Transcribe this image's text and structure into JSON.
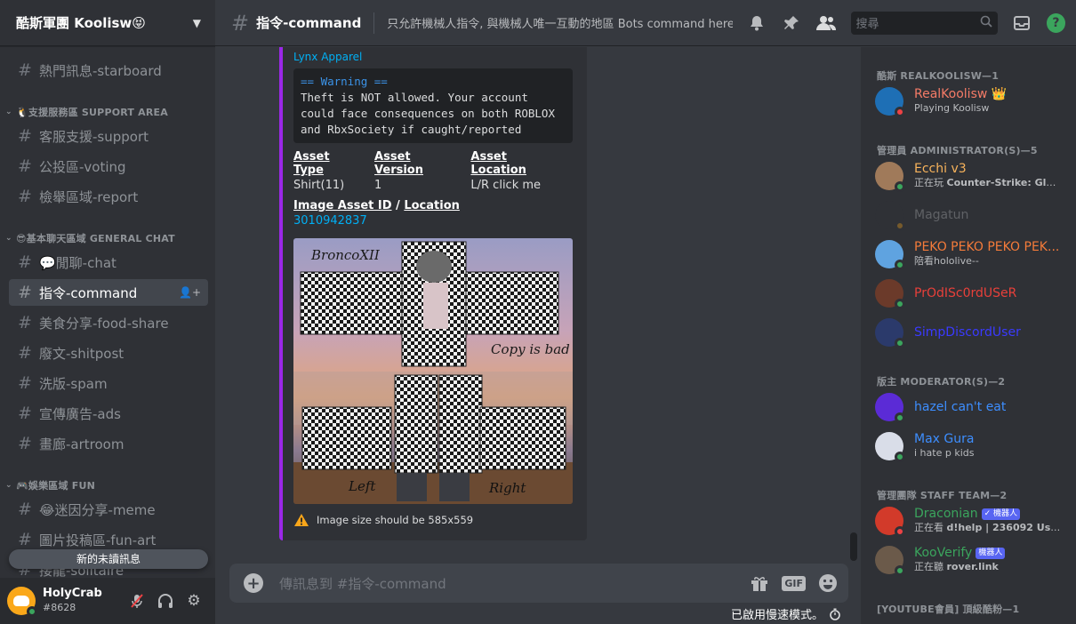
{
  "server": {
    "name": "酷斯軍團 Koolisw😝"
  },
  "sidebar": {
    "top_channel": "熱門訊息-starboard",
    "categories": [
      {
        "name": "🐧支援服務區 SUPPORT AREA",
        "channels": [
          "客服支援-support",
          "公投區-voting",
          "檢舉區域-report"
        ]
      },
      {
        "name": "😎基本聊天區域 GENERAL CHAT",
        "channels": [
          "💬閒聊-chat",
          "指令-command",
          "美食分享-food-share",
          "廢文-shitpost",
          "洗版-spam",
          "宣傳廣告-ads",
          "畫廊-artroom"
        ]
      },
      {
        "name": "🎮娛樂區域 FUN",
        "channels": [
          "😂迷因分享-meme",
          "圖片投稿區-fun-art",
          "接龍-solitaire"
        ]
      }
    ],
    "active_channel": "指令-command",
    "unread_pill": "新的未讀訊息"
  },
  "user": {
    "name": "HolyCrab",
    "tag": "#8628"
  },
  "header": {
    "channel": "指令-command",
    "topic": "只允許機械人指令, 與機械人唯一互動的地區 Bots command here.",
    "search_placeholder": "搜尋"
  },
  "embed": {
    "provider": "Lynx Apparel",
    "code_warning": "== Warning ==",
    "code_body": "Theft is NOT allowed. Your account\ncould face consequences on both ROBLOX\nand RbxSociety if caught/reported",
    "fields": [
      {
        "name": "Asset Type",
        "value": "Shirt(11)"
      },
      {
        "name": "Asset Version",
        "value": "1"
      },
      {
        "name": "Asset Location",
        "value": "L/R click me"
      }
    ],
    "image_field_a": "Image Asset ID",
    "image_field_sep": " / ",
    "image_field_b": "Location",
    "image_asset_id": "3010942837",
    "image_texts": {
      "creator": "BroncoXII",
      "copy": "Copy is bad",
      "left": "Left",
      "right": "Right"
    },
    "footer": "Image size should be 585x559"
  },
  "composer": {
    "placeholder": "傳訊息到 #指令-command",
    "slowmode": "已啟用慢速模式。"
  },
  "members": {
    "groups": [
      {
        "title": "酷斯 REALKOOLISW—1",
        "members": [
          {
            "name": "RealKoolisw",
            "suffix": "👑",
            "activity": "Playing Koolisw",
            "color": "#f47b67",
            "status": "dnd",
            "avatar": "#1e6fb5"
          }
        ]
      },
      {
        "title": "管理員 ADMINISTRATOR(S)—5",
        "members": [
          {
            "name": "Ecchi v3",
            "activity_prefix": "正在玩 ",
            "activity": "Counter-Strike: Global ...",
            "color": "#f8b35b",
            "status": "online",
            "avatar": "#a07a5a"
          },
          {
            "name": "Magatun",
            "activity": "",
            "color": "#b9bbbe",
            "status": "idle",
            "avatar": "#2f3136",
            "faded": true
          },
          {
            "name": "PEKO PEKO PEKO PEK...",
            "activity": "陪看hololive--",
            "color": "#f47b3a",
            "status": "online",
            "avatar": "#5fa3e0"
          },
          {
            "name": "PrOdISc0rdUSeR",
            "activity": "",
            "color": "#e8403a",
            "status": "online",
            "avatar": "#6b3a2a"
          },
          {
            "name": "SimpDiscordUser",
            "activity": "",
            "color": "#3a3aff",
            "status": "online",
            "avatar": "#2b3a6b"
          }
        ]
      },
      {
        "title": "版主 MODERATOR(S)—2",
        "members": [
          {
            "name": "hazel can't eat",
            "activity": "",
            "color": "#3d8eff",
            "status": "online",
            "avatar": "#5b2bd6"
          },
          {
            "name": "Max Gura",
            "activity": "i hate p kids",
            "color": "#3d8eff",
            "status": "online",
            "avatar": "#d9dde8"
          }
        ]
      },
      {
        "title": "管理團隊 STAFF TEAM—2",
        "members": [
          {
            "name": "Draconian",
            "bot": "✓ 機器人",
            "activity_prefix": "正在看 ",
            "activity": "d!help | 236092 Users",
            "color": "#3ba55d",
            "status": "dnd",
            "avatar": "#d23a2a"
          },
          {
            "name": "KooVerify",
            "bot": "機器人",
            "activity_prefix": "正在聽 ",
            "activity": "rover.link",
            "color": "#3ba55d",
            "status": "online",
            "avatar": "#6b5a4a"
          }
        ]
      },
      {
        "title": "[YOUTUBE會員] 頂級酷粉—1",
        "members": []
      }
    ]
  },
  "colors": {
    "accent_bar": "#9b27e8",
    "link": "#00aff4",
    "online": "#3ba55d",
    "dnd": "#ed4245"
  }
}
